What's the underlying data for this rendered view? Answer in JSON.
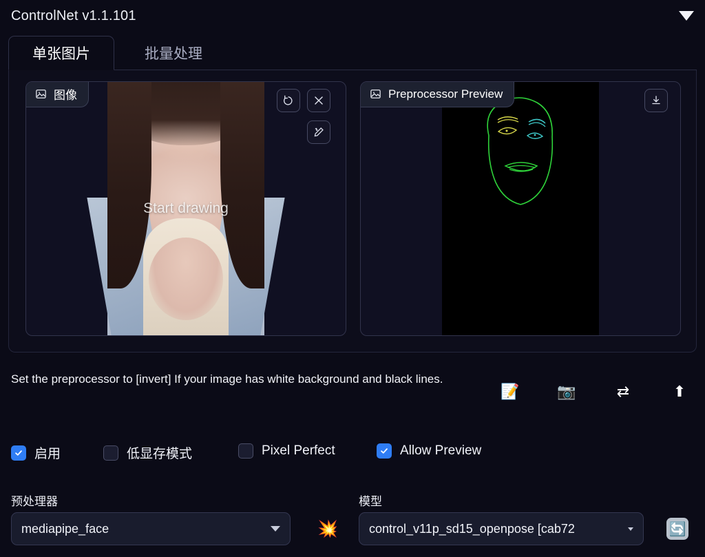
{
  "header": {
    "title": "ControlNet v1.1.101",
    "collapse_icon": "triangle-down-icon"
  },
  "tabs": [
    {
      "label": "单张图片",
      "active": true
    },
    {
      "label": "批量处理",
      "active": false
    }
  ],
  "panels": {
    "image": {
      "badge_label": "图像",
      "badge_icon": "image-icon",
      "overlay_text": "Start drawing",
      "buttons": [
        {
          "name": "undo-button",
          "icon": "undo-icon"
        },
        {
          "name": "clear-button",
          "icon": "close-icon"
        },
        {
          "name": "draw-button",
          "icon": "pen-icon"
        }
      ]
    },
    "preview": {
      "badge_label": "Preprocessor Preview",
      "badge_icon": "image-icon",
      "buttons": [
        {
          "name": "download-button",
          "icon": "download-icon"
        }
      ],
      "face_colors": {
        "outline": "#2fd23a",
        "brow_left": "#d8d84a",
        "eye_left": "#d8d84a",
        "brow_right": "#3ec8c8",
        "eye_right": "#3ec8c8",
        "lips": "#2fd23a"
      }
    }
  },
  "hint": {
    "text": "Set the preprocessor to [invert] If your image has white background and black lines.",
    "icons": [
      {
        "name": "memo-icon",
        "glyph": "📝"
      },
      {
        "name": "camera-icon",
        "glyph": "📷"
      },
      {
        "name": "swap-icon",
        "glyph": "⇄"
      },
      {
        "name": "upload-arrow-icon",
        "glyph": "⬆"
      }
    ]
  },
  "checkboxes": [
    {
      "label": "启用",
      "checked": true
    },
    {
      "label": "低显存模式",
      "checked": false
    },
    {
      "label": "Pixel Perfect",
      "checked": false
    },
    {
      "label": "Allow Preview",
      "checked": true
    }
  ],
  "fields": {
    "preprocessor": {
      "label": "预处理器",
      "value": "mediapipe_face"
    },
    "model": {
      "label": "模型",
      "value": "control_v11p_sd15_openpose [cab72"
    },
    "boom_icon": "💥",
    "refresh_icon": "🔄"
  },
  "colors": {
    "background": "#0b0b17",
    "accent": "#2f7df4",
    "panel": "#101022",
    "border": "#32344c"
  }
}
